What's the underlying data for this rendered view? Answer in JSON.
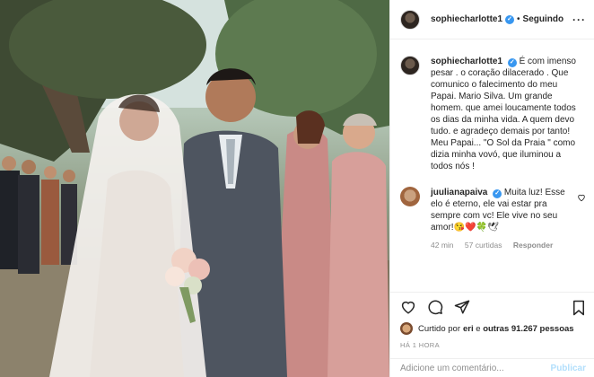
{
  "post": {
    "username": "sophiecharlotte1",
    "follow_status": "Seguindo",
    "caption": "É com imenso pesar . o coração dilacerado . Que comunico o falecimento do meu Papai. Mario Silva. Um grande homem. que amei loucamente todos os dias da minha vida. A quem devo tudo. e agradeço demais por tanto! Meu Papai... \"O Sol da Praia \" como dizia minha vovó, que iluminou a todos nós !"
  },
  "comment": {
    "username": "juulianapaiva",
    "text": "Muita luz! Esse elo é eterno, ele vai estar pra sempre com vc! Ele vive no seu amor!😘❤️🍀🕊",
    "time": "42 min",
    "likes": "57 curtidas",
    "reply": "Responder"
  },
  "likes_line": {
    "prefix": "Curtido por ",
    "user": "eri",
    "middle": " e ",
    "others": "outras 91.267 pessoas"
  },
  "timestamp": "HÁ 1 HORA",
  "add_comment": {
    "placeholder": "Adicione um comentário...",
    "publish": "Publicar"
  },
  "icons": [
    "more-icon",
    "verified-icon",
    "heart-icon",
    "comment-icon",
    "share-icon",
    "bookmark-icon"
  ],
  "colors": {
    "verified": "#3897f0",
    "text": "#262626",
    "muted": "#8e8e8e",
    "publish": "#b2dffc"
  }
}
